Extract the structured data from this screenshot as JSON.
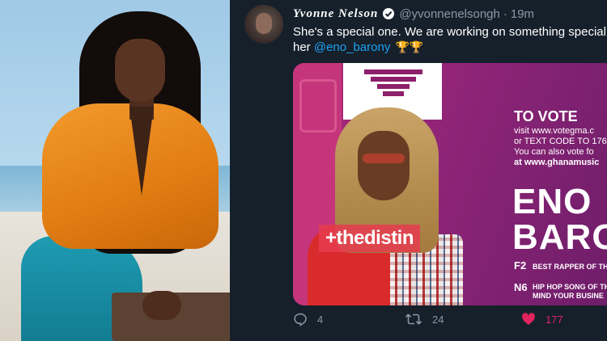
{
  "tweet": {
    "display_name": "Yvonne Nelson",
    "handle": "@yvonnenelsongh",
    "separator": "·",
    "time": "19m",
    "text_line1": "She's a special one. We are working on something special",
    "text_line2_prefix": "her ",
    "mention": "@eno_barony",
    "emoji": "🏆🏆",
    "icons": {
      "verified": "verified-badge-icon",
      "trophy": "trophy-icon"
    }
  },
  "media": {
    "watermark": "+thedistin",
    "vote_title": "TO VOTE",
    "vote_lines": [
      "visit www.votegma.c",
      "or TEXT CODE TO 176",
      "You can also vote fo",
      "at www.ghanamusic"
    ],
    "nominee_first": "ENO",
    "nominee_last": "BARO",
    "categories": [
      {
        "code": "F2",
        "desc": "BEST RAPPER OF TH"
      },
      {
        "code": "N6",
        "desc": "HIP HOP SONG OF TH"
      }
    ],
    "song_title": "MIND YOUR BUSINE"
  },
  "actions": {
    "reply_count": "4",
    "retweet_count": "24",
    "like_count": "177",
    "icons": {
      "reply": "reply-icon",
      "retweet": "retweet-icon",
      "like": "heart-icon"
    }
  },
  "colors": {
    "tweet_bg": "#15202b",
    "link": "#1da1f2",
    "muted": "#8899a6",
    "like": "#e0245e",
    "card_magenta": "#8e2477"
  }
}
